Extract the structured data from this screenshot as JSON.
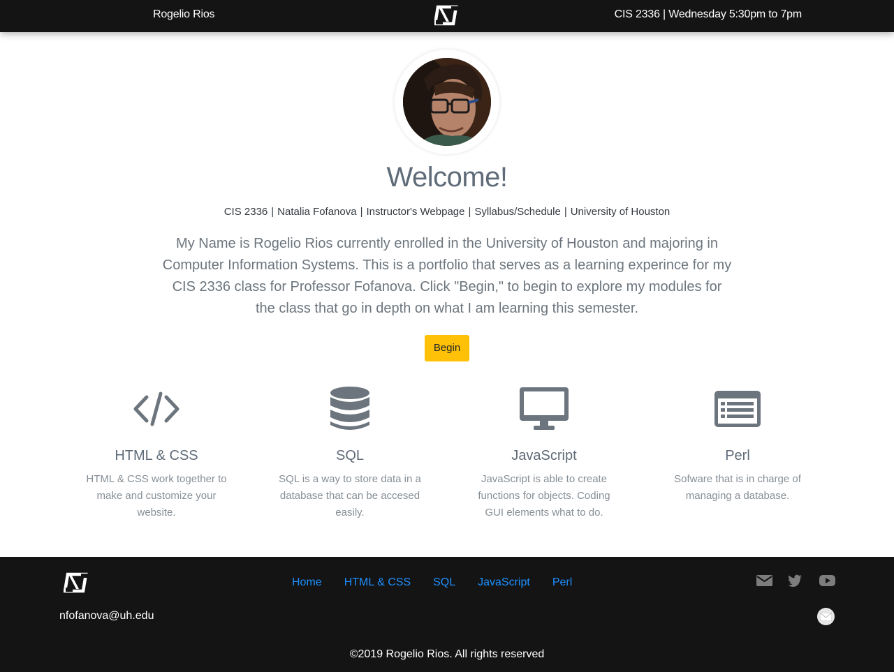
{
  "header": {
    "name": "Rogelio Rios",
    "logo_icon": "brand-logo-icon",
    "schedule": "CIS 2336 | Wednesday 5:30pm to 7pm"
  },
  "hero": {
    "avatar_icon": "profile-photo",
    "title": "Welcome!",
    "links": [
      {
        "label": "CIS 2336"
      },
      {
        "label": "Natalia Fofanova"
      },
      {
        "label": "Instructor's Webpage"
      },
      {
        "label": "Syllabus/Schedule"
      },
      {
        "label": "University of Houston"
      }
    ],
    "separator": "|",
    "intro": "My Name is Rogelio Rios currently enrolled in the University of Houston and majoring in Computer Information Systems. This is a portfolio that serves as a learning experince for my CIS 2336 class for Professor Fofanova. Click \"Begin,\" to begin to explore my modules for the class that go in depth on what I am learning this semester.",
    "begin_label": "Begin",
    "begin_color": "#ffc107"
  },
  "features": [
    {
      "icon": "code-icon",
      "title": "HTML & CSS",
      "text": "HTML & CSS work together to make and customize your website."
    },
    {
      "icon": "database-icon",
      "title": "SQL",
      "text": "SQL is a way to store data in a database that can be accesed easily."
    },
    {
      "icon": "desktop-icon",
      "title": "JavaScript",
      "text": "JavaScript is able to create functions for objects. Coding GUI elements what to do."
    },
    {
      "icon": "list-alt-icon",
      "title": "Perl",
      "text": "Sofware that is in charge of managing a database."
    }
  ],
  "footer": {
    "nav": [
      "Home",
      "HTML & CSS",
      "SQL",
      "JavaScript",
      "Perl"
    ],
    "link_color": "#1e90ff",
    "email": "nfofanova@uh.edu",
    "social_icons": [
      "envelope-icon",
      "twitter-icon",
      "youtube-icon"
    ],
    "mail_round_icon": "mail-round-icon",
    "copyright": "©2019 Rogelio Rios. All rights reserved"
  }
}
